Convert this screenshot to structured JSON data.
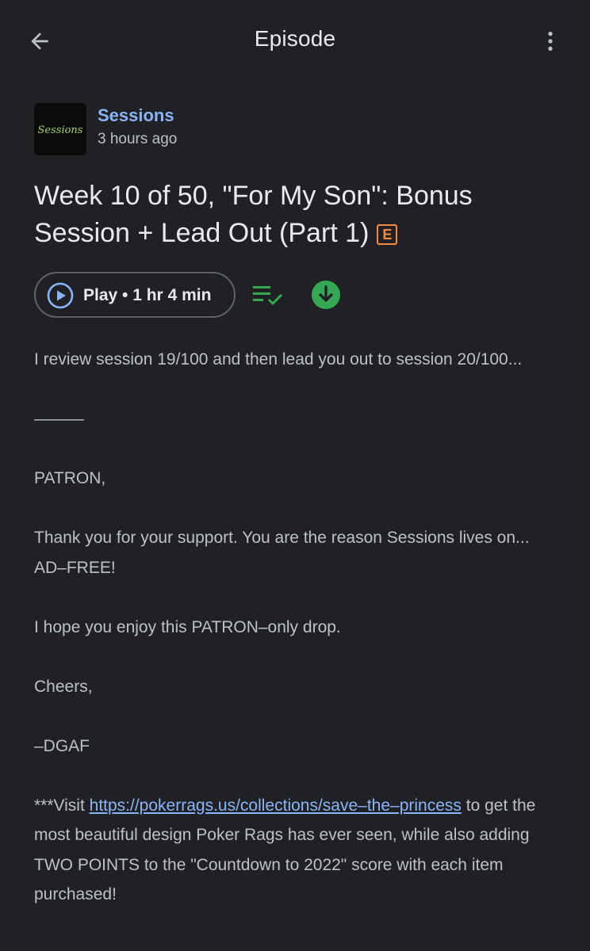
{
  "appbar": {
    "title": "Episode",
    "back_icon": "arrow-back-icon",
    "more_icon": "more-vert-icon"
  },
  "podcast": {
    "name": "Sessions",
    "published": "3 hours ago",
    "art_text": "Sessions",
    "art_text_color": "#9bd35a"
  },
  "episode": {
    "title": "Week 10 of 50, \"For My Son\": Bonus Session + Lead Out (Part 1)",
    "explicit_badge": "E"
  },
  "actions": {
    "play_label": "Play • 1 hr 4 min",
    "play_icon": "play-circle-icon",
    "queue_icon": "playlist-added-icon",
    "download_icon": "downloaded-icon"
  },
  "description": {
    "p1": "I review session 19/100 and then lead you out to session 20/100...",
    "p2": "———",
    "p3": "PATRON,",
    "p4": "Thank you for your support. You are the reason Sessions lives on... AD–FREE!",
    "p5": "I hope you enjoy this PATRON–only drop.",
    "p6": "Cheers,",
    "p7": "–DGAF",
    "p8_prefix": "***Visit ",
    "p8_link": "https://pokerrags.us/collections/save–the–princess",
    "p8_suffix": " to get the most beautiful design Poker Rags has ever seen, while also adding TWO POINTS to the \"Countdown to 2022\" score with each item purchased!"
  },
  "colors": {
    "background": "#202124",
    "accent_blue": "#8ab4f8",
    "explicit_orange": "#f28b3b",
    "green": "#34a853"
  }
}
